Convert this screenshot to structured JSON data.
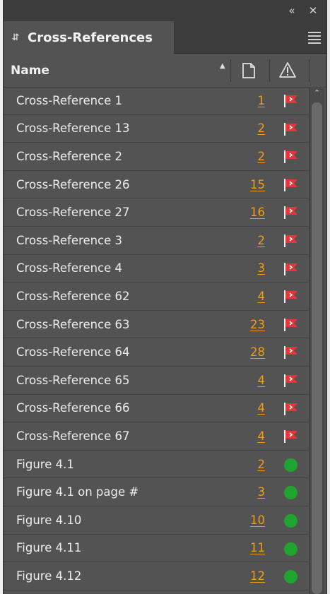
{
  "window": {
    "collapse_icon": "double-chevron-left-icon",
    "close_icon": "close-icon"
  },
  "panel": {
    "title": "Cross-References",
    "menu_icon": "hamburger-menu-icon"
  },
  "header": {
    "name_label": "Name",
    "sort_icon": "sort-ascending-icon",
    "page_icon": "page-icon",
    "status_icon": "warning-icon"
  },
  "items": [
    {
      "label": "Cross-Reference 1",
      "page": "1",
      "status": "missing"
    },
    {
      "label": "Cross-Reference 13",
      "page": "2",
      "status": "missing"
    },
    {
      "label": "Cross-Reference 2",
      "page": "2",
      "status": "missing"
    },
    {
      "label": "Cross-Reference 26",
      "page": "15",
      "status": "missing"
    },
    {
      "label": "Cross-Reference 27",
      "page": "16",
      "status": "missing"
    },
    {
      "label": "Cross-Reference 3",
      "page": "2",
      "status": "missing"
    },
    {
      "label": "Cross-Reference 4",
      "page": "3",
      "status": "missing"
    },
    {
      "label": "Cross-Reference 62",
      "page": "4",
      "status": "missing"
    },
    {
      "label": "Cross-Reference 63",
      "page": "23",
      "status": "missing"
    },
    {
      "label": "Cross-Reference 64",
      "page": "28",
      "status": "missing"
    },
    {
      "label": "Cross-Reference 65",
      "page": "4",
      "status": "missing"
    },
    {
      "label": "Cross-Reference 66",
      "page": "4",
      "status": "missing"
    },
    {
      "label": "Cross-Reference 67",
      "page": "4",
      "status": "missing"
    },
    {
      "label": "Figure 4.1",
      "page": "2",
      "status": "ok"
    },
    {
      "label": "Figure 4.1 on page #",
      "page": "3",
      "status": "ok"
    },
    {
      "label": "Figure 4.10",
      "page": "10",
      "status": "ok"
    },
    {
      "label": "Figure 4.11",
      "page": "11",
      "status": "ok"
    },
    {
      "label": "Figure 4.12",
      "page": "12",
      "status": "ok"
    }
  ],
  "colors": {
    "panel_bg": "#535353",
    "page_link": "#f39c12",
    "flag_red": "#e8353a",
    "ok_green": "#1fa52f"
  }
}
